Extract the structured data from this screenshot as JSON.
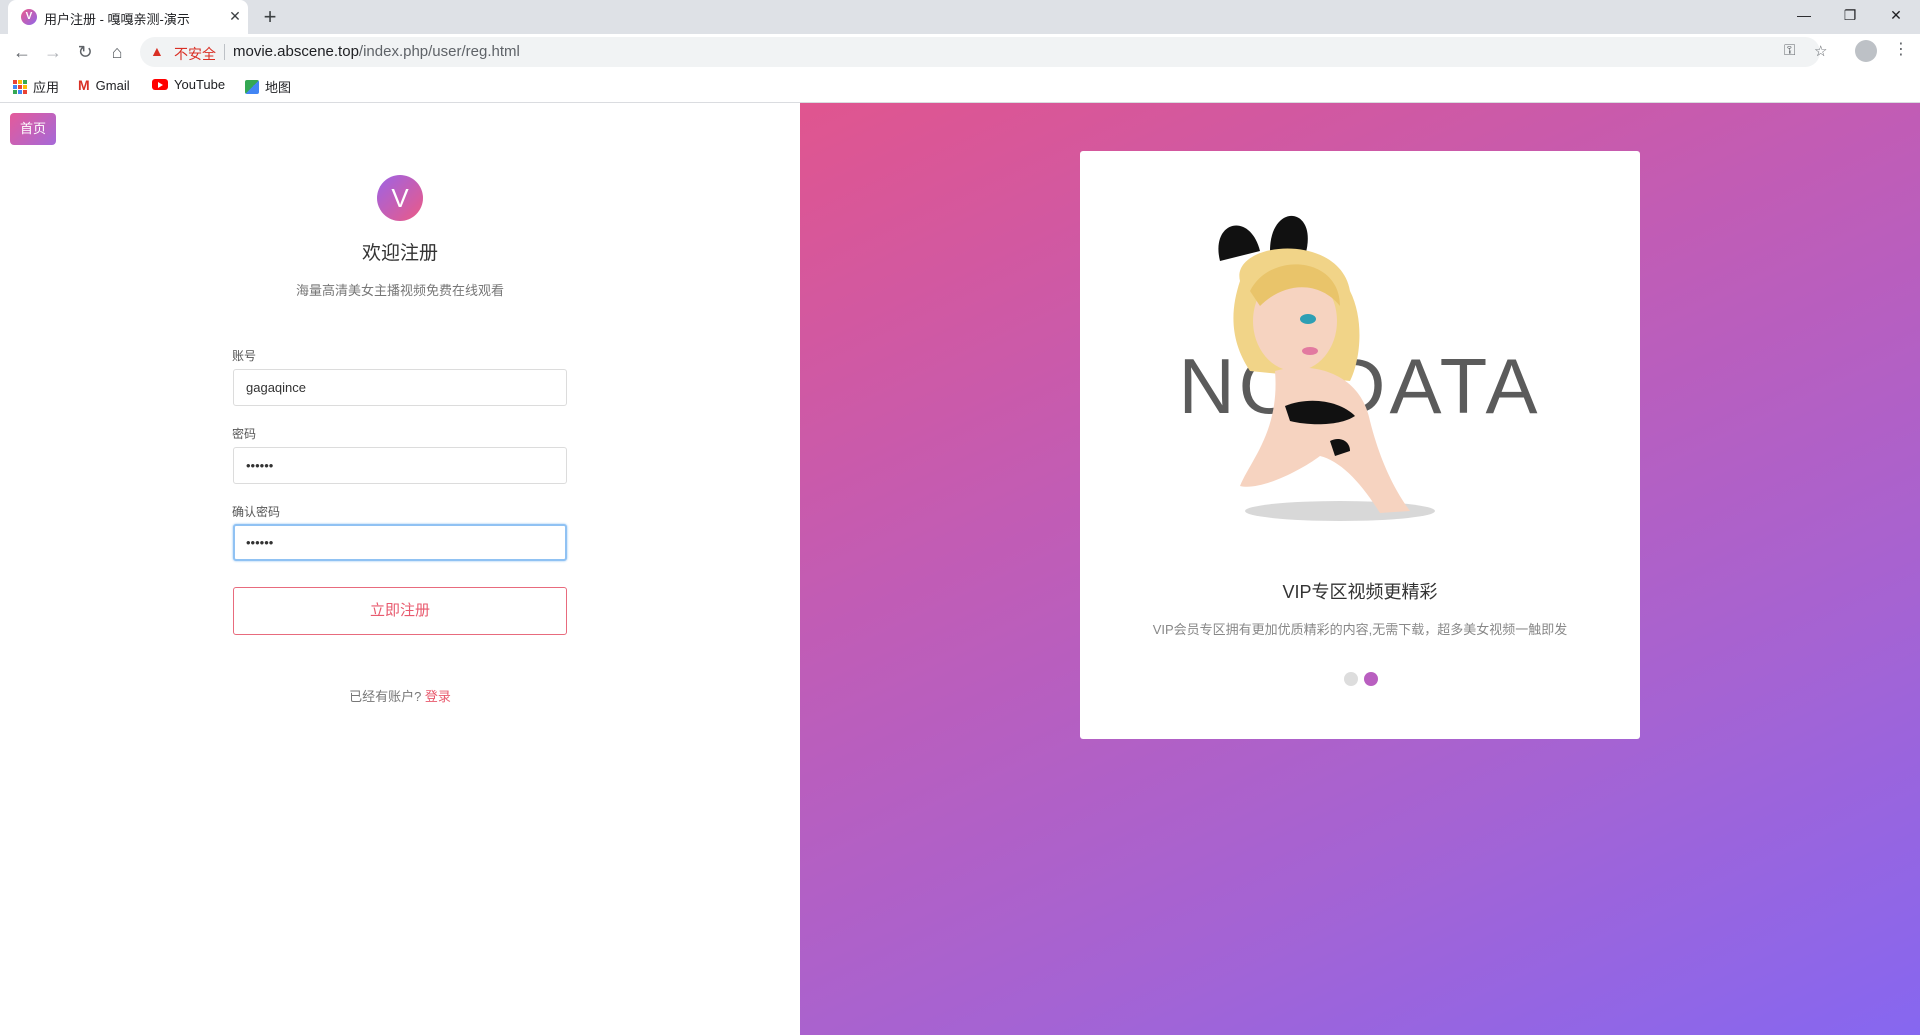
{
  "browser": {
    "tab_title": "用户注册 - 嘎嘎亲测-演示",
    "tab_favicon_letter": "V",
    "security_label": "不安全",
    "url_domain": "movie.abscene.top",
    "url_path": "/index.php/user/reg.html",
    "bookmarks": [
      {
        "label": "应用",
        "icon": "apps-grid-icon"
      },
      {
        "label": "Gmail",
        "icon": "gmail-icon"
      },
      {
        "label": "YouTube",
        "icon": "youtube-icon"
      },
      {
        "label": "地图",
        "icon": "maps-icon"
      }
    ]
  },
  "nav": {
    "home_label": "首页"
  },
  "register": {
    "logo_letter": "V",
    "title": "欢迎注册",
    "subtitle": "海量高清美女主播视频免费在线观看",
    "account_label": "账号",
    "account_value": "gagaqince",
    "password_label": "密码",
    "password_value": "••••••",
    "confirm_label": "确认密码",
    "confirm_value": "••••••",
    "submit_label": "立即注册",
    "have_account_text": "已经有账户?",
    "login_link": "登录"
  },
  "promo": {
    "image_text": "NO DATA",
    "title": "VIP专区视频更精彩",
    "description": "VIP会员专区拥有更加优质精彩的内容,无需下载，超多美女视频一触即发",
    "slides_total": 2,
    "active_slide": 2
  },
  "colors": {
    "accent": "#e85a6e",
    "gradient_start": "#e0558f",
    "gradient_end": "#8667f0"
  }
}
